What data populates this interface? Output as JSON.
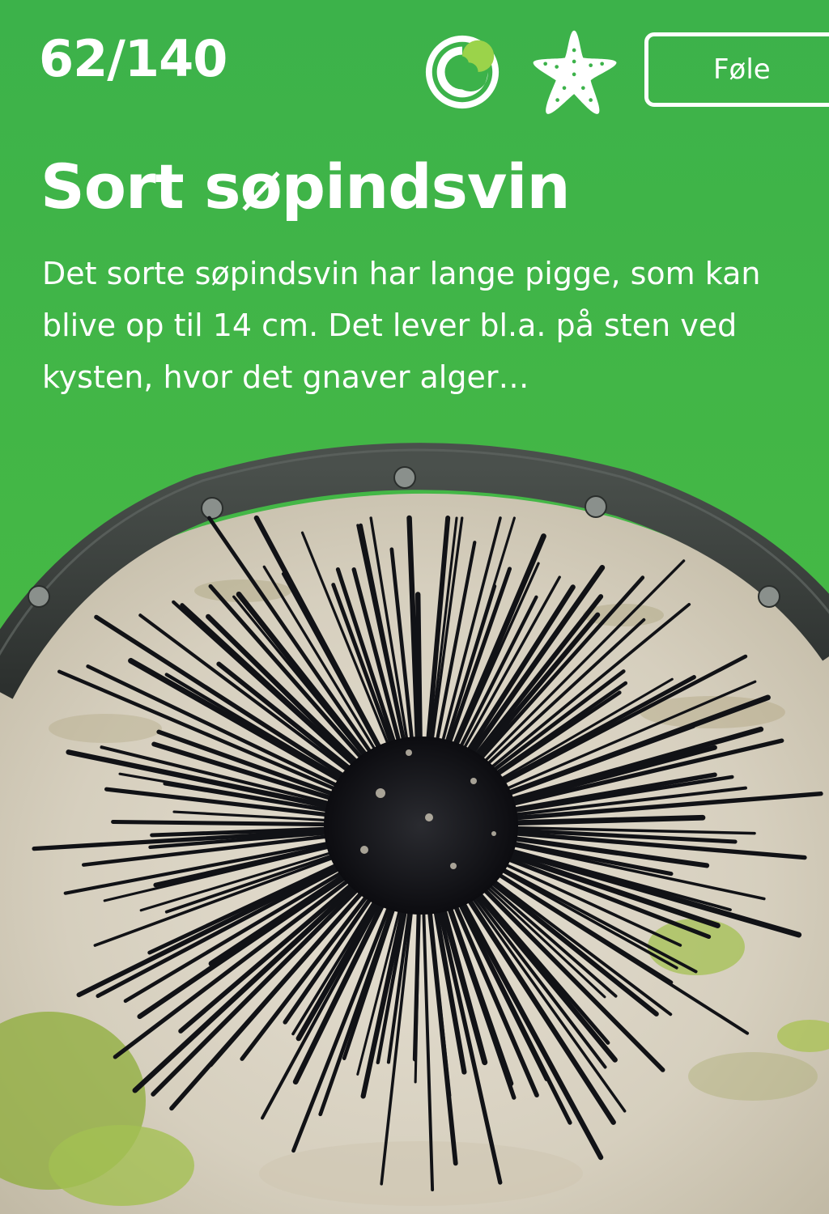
{
  "card": {
    "counter": "62/140",
    "title": "Sort søpindsvin",
    "description": "Det sorte søpindsvin har lange pigge, som kan blive op til 14 cm. Det lever bl.a. på sten ved kysten, hvor det gnaver alger…",
    "sense_label": "Føle"
  },
  "icons": {
    "badge": "swirl-logo-icon",
    "category": "starfish-icon"
  },
  "colors": {
    "background_top": "#3cb24a",
    "background_bottom": "#7cc73f",
    "text": "#ffffff",
    "ring": "#3a3f3c",
    "urchin": "#141518",
    "sand": "#d9d3c3"
  }
}
